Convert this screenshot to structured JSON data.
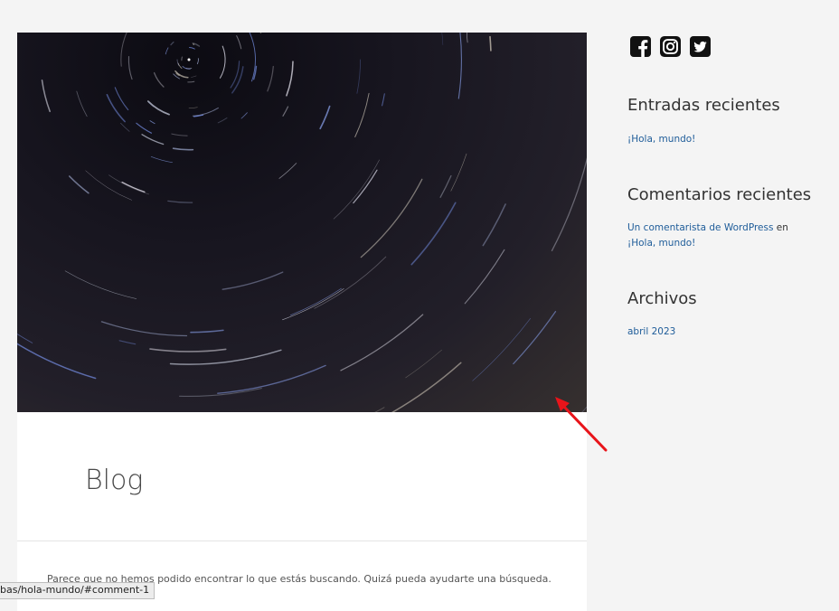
{
  "post": {
    "title": "Blog",
    "no_results_text": "Parece que no hemos podido encontrar lo que estás buscando. Quizá pueda ayudarte una búsqueda."
  },
  "sidebar": {
    "social_icons": [
      "facebook-icon",
      "instagram-icon",
      "twitter-icon"
    ],
    "recent_posts": {
      "title": "Entradas recientes",
      "items": [
        "¡Hola, mundo!"
      ]
    },
    "recent_comments": {
      "title": "Comentarios recientes",
      "author": "Un comentarista de WordPress",
      "connector": " en ",
      "post": "¡Hola, mundo!"
    },
    "archives": {
      "title": "Archivos",
      "items": [
        "abril 2023"
      ]
    }
  },
  "statusbar": {
    "url": "bas/hola-mundo/#comment-1"
  },
  "colors": {
    "link": "#1e5c99",
    "annotation_arrow": "#e8141a",
    "page_background": "#f4f4f4"
  }
}
